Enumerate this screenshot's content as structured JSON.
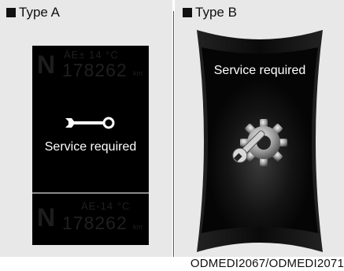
{
  "type_a": {
    "title": "Type A",
    "ghost_top_indicator": "N",
    "ghost_top_temp": "ÄE± 14 °C",
    "ghost_top_odometer": "178262",
    "ghost_top_unit": "km",
    "message": "Service required",
    "ghost_bottom_indicator": "N",
    "ghost_bottom_temp": "ÄE-14 °C",
    "ghost_bottom_odometer": "178262",
    "ghost_bottom_unit": "km"
  },
  "type_b": {
    "title": "Type B",
    "message": "Service required"
  },
  "caption": "ODMEDI2067/ODMEDI2071"
}
